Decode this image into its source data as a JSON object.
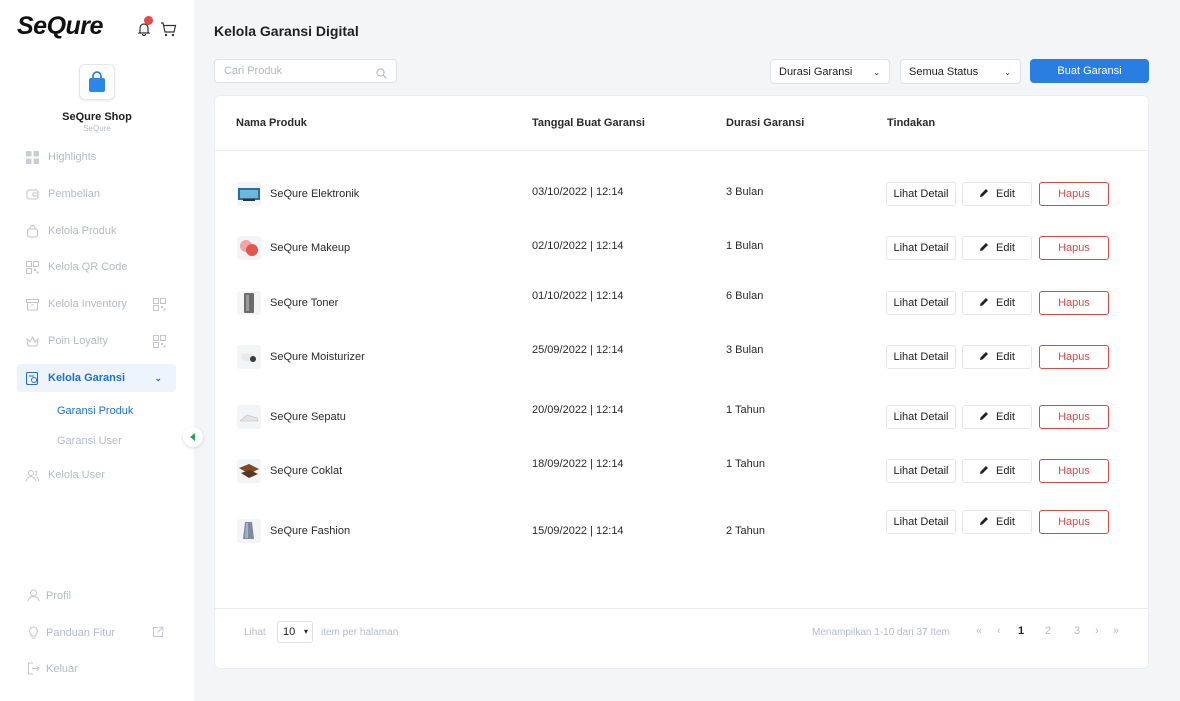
{
  "app": {
    "logo": "SeQure"
  },
  "notification": {
    "badge_color": "#e5484d"
  },
  "shop": {
    "name": "SeQure Shop",
    "subtitle": "SeQure"
  },
  "sidebar": {
    "items": [
      {
        "label": "Highlights",
        "icon": "grid-icon"
      },
      {
        "label": "Pembelian",
        "icon": "wallet-icon"
      },
      {
        "label": "Kelola Produk",
        "icon": "bag-icon"
      },
      {
        "label": "Kelola QR Code",
        "icon": "qr-icon"
      },
      {
        "label": "Kelola Inventory",
        "icon": "box-icon"
      },
      {
        "label": "Poin Loyalty",
        "icon": "crown-icon"
      },
      {
        "label": "Kelola Garansi",
        "icon": "warranty-icon"
      },
      {
        "label": "Kelola User",
        "icon": "users-icon"
      }
    ],
    "sub_items": [
      {
        "label": "Garansi Produk"
      },
      {
        "label": "Garansi User"
      }
    ],
    "bottom": [
      {
        "label": "Profil",
        "icon": "user-icon"
      },
      {
        "label": "Panduan Fitur",
        "icon": "bulb-icon"
      },
      {
        "label": "Keluar",
        "icon": "logout-icon"
      }
    ]
  },
  "page": {
    "title": "Kelola Garansi Digital"
  },
  "toolbar": {
    "search_placeholder": "Cari Produk",
    "duration_select": "Durasi Garansi",
    "status_select": "Semua Status",
    "create_button": "Buat Garansi"
  },
  "table": {
    "columns": [
      "Nama Produk",
      "Tanggal Buat Garansi",
      "Durasi Garansi",
      "Tindakan"
    ],
    "actions": {
      "detail": "Lihat Detail",
      "edit": "Edit",
      "delete": "Hapus"
    },
    "rows": [
      {
        "name": "SeQure Elektronik",
        "date": "03/10/2022 | 12:14",
        "duration": "3 Bulan"
      },
      {
        "name": "SeQure Makeup",
        "date": "02/10/2022 | 12:14",
        "duration": "1 Bulan"
      },
      {
        "name": "SeQure Toner",
        "date": "01/10/2022 | 12:14",
        "duration": "6 Bulan"
      },
      {
        "name": "SeQure Moisturizer",
        "date": "25/09/2022 | 12:14",
        "duration": "3 Bulan"
      },
      {
        "name": "SeQure Sepatu",
        "date": "20/09/2022 | 12:14",
        "duration": "1 Tahun"
      },
      {
        "name": "SeQure Coklat",
        "date": "18/09/2022 | 12:14",
        "duration": "1 Tahun"
      },
      {
        "name": "SeQure Fashion",
        "date": "15/09/2022 | 12:14",
        "duration": "2 Tahun"
      }
    ]
  },
  "pagination": {
    "show_label": "Lihat",
    "per_page": "10",
    "per_page_label": "item per halaman",
    "showing": "Menampilkan 1-10 dari 37 Item",
    "first": "«",
    "prev": "‹",
    "pages": [
      "1",
      "2",
      "3"
    ],
    "next": "›",
    "last": "»"
  },
  "colors": {
    "primary": "#2a7de1",
    "danger": "#e04848",
    "active_nav": "#1f6fd6"
  }
}
